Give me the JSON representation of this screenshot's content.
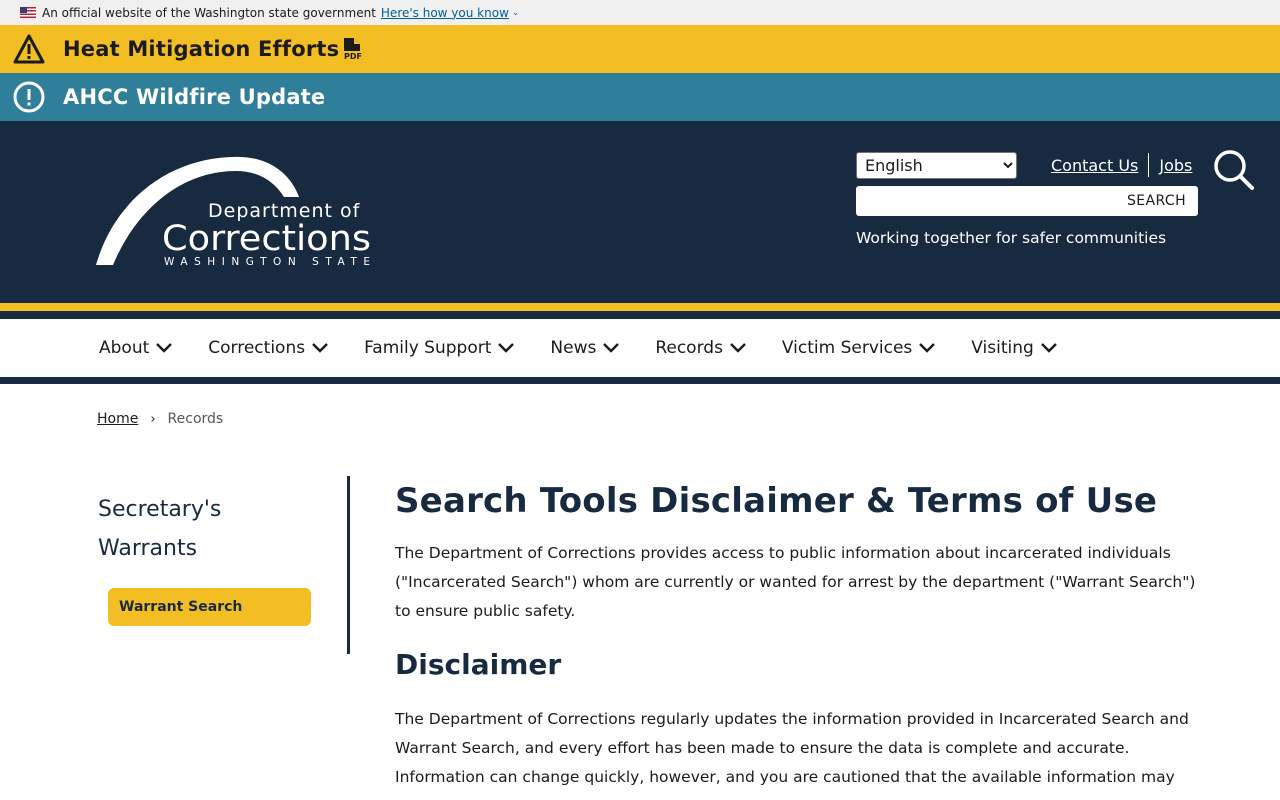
{
  "gov_banner": {
    "text": "An official website of the Washington state government",
    "link": "Here's how you know"
  },
  "alerts": [
    {
      "title": "Heat Mitigation Efforts",
      "icon": "warning-triangle-icon",
      "color": "#f2be24"
    },
    {
      "title": "AHCC Wildfire Update",
      "icon": "exclamation-circle-icon",
      "color": "#2f7f9a"
    }
  ],
  "header": {
    "logo": {
      "line1": "Department of",
      "line2": "Corrections",
      "line3": "WASHINGTON STATE"
    },
    "language": "English",
    "contact_link": "Contact Us",
    "jobs_link": "Jobs",
    "search_label": "SEARCH",
    "tagline": "Working together for safer communities",
    "colors": {
      "navy": "#182a40",
      "gold": "#f2be24"
    }
  },
  "nav": {
    "items": [
      {
        "label": "About"
      },
      {
        "label": "Corrections"
      },
      {
        "label": "Family Support"
      },
      {
        "label": "News"
      },
      {
        "label": "Records"
      },
      {
        "label": "Victim Services"
      },
      {
        "label": "Visiting"
      }
    ]
  },
  "breadcrumb": {
    "home": "Home",
    "current": "Records"
  },
  "sidebar": {
    "title": "Secretary's Warrants",
    "button": "Warrant Search"
  },
  "content": {
    "title": "Search Tools Disclaimer & Terms of Use",
    "intro": "The Department of Corrections provides access to public information about incarcerated individuals (\"Incarcerated Search\") whom are currently or wanted for arrest by the department (\"Warrant Search\") to ensure public safety.",
    "disclaimer_heading": "Disclaimer",
    "disclaimer_text": "The Department of Corrections regularly updates the information provided in Incarcerated Search and Warrant Search, and every effort has been made to ensure the data is complete and accurate. Information can change quickly, however, and you are cautioned that the available information may"
  }
}
